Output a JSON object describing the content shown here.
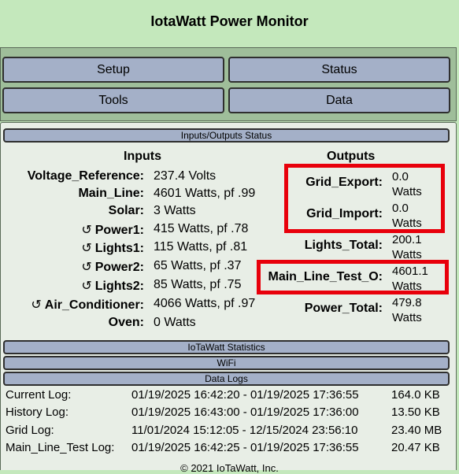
{
  "app": {
    "title": "IotaWatt Power Monitor"
  },
  "nav": {
    "setup": "Setup",
    "status": "Status",
    "tools": "Tools",
    "data": "Data"
  },
  "sections": {
    "io_status": "Inputs/Outputs Status",
    "statistics": "IoTaWatt Statistics",
    "wifi": "WiFi",
    "data_logs": "Data Logs"
  },
  "inputs": {
    "heading": "Inputs",
    "refresh_icon": "↺",
    "items": [
      {
        "name": "Voltage_Reference:",
        "value": "237.4 Volts",
        "refresh": false
      },
      {
        "name": "Main_Line:",
        "value": "4601 Watts, pf .99",
        "refresh": false
      },
      {
        "name": "Solar:",
        "value": "3 Watts",
        "refresh": false
      },
      {
        "name": "Power1:",
        "value": "415 Watts, pf .78",
        "refresh": true
      },
      {
        "name": "Lights1:",
        "value": "115 Watts, pf .81",
        "refresh": true
      },
      {
        "name": "Power2:",
        "value": "65 Watts, pf .37",
        "refresh": true
      },
      {
        "name": "Lights2:",
        "value": "85 Watts, pf .75",
        "refresh": true
      },
      {
        "name": "Air_Conditioner:",
        "value": "4066 Watts, pf .97",
        "refresh": true
      },
      {
        "name": "Oven:",
        "value": "0 Watts",
        "refresh": false
      }
    ]
  },
  "outputs": {
    "heading": "Outputs",
    "items": [
      {
        "name": "Grid_Export:",
        "value": "0.0",
        "unit": "Watts"
      },
      {
        "name": "Grid_Import:",
        "value": "0.0",
        "unit": "Watts"
      },
      {
        "name": "Lights_Total:",
        "value": "200.1",
        "unit": "Watts"
      },
      {
        "name": "Main_Line_Test_O:",
        "value": "4601.1",
        "unit": "Watts"
      },
      {
        "name": "Power_Total:",
        "value": "479.8",
        "unit": "Watts"
      }
    ]
  },
  "highlight_color": "#e8000b",
  "logs": [
    {
      "name": "Current Log:",
      "range": "01/19/2025 16:42:20 - 01/19/2025 17:36:55",
      "size": "164.0 KB"
    },
    {
      "name": "History Log:",
      "range": "01/19/2025 16:43:00 - 01/19/2025 17:36:00",
      "size": "13.50 KB"
    },
    {
      "name": "Grid Log:",
      "range": "11/01/2024 15:12:05 - 12/15/2024 23:56:10",
      "size": "23.40 MB"
    },
    {
      "name": "Main_Line_Test Log:",
      "range": "01/19/2025 16:42:25 - 01/19/2025 17:36:55",
      "size": "20.47 KB"
    }
  ],
  "footer": {
    "copyright": "© 2021 IoTaWatt, Inc."
  }
}
